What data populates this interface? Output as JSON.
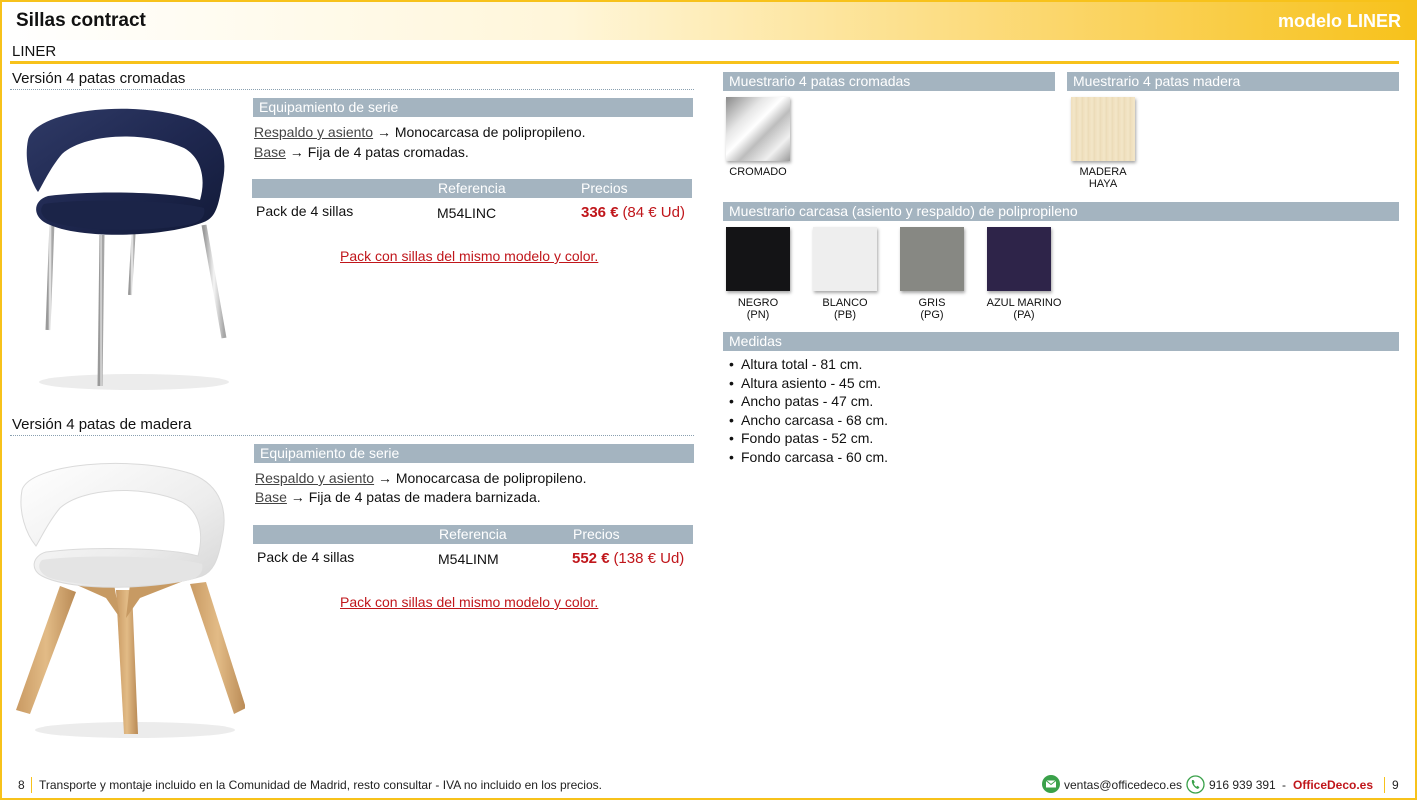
{
  "header": {
    "title": "Sillas contract",
    "model": "modelo LINER"
  },
  "model_name": "LINER",
  "versions": [
    {
      "title": "Versión 4 patas cromadas",
      "equip_title": "Equipamiento de serie",
      "spec1_label": "Respaldo y asiento",
      "spec1_text": " → Monocarcasa de polipropileno.",
      "spec2_label": "Base",
      "spec2_text": " → Fija de 4 patas cromadas.",
      "table": {
        "col_ref": "Referencia",
        "col_price": "Precios",
        "item": "Pack de 4 sillas",
        "ref": "M54LINC",
        "price": "336 €",
        "unit_price": "(84 € Ud)"
      },
      "note": "Pack con sillas del mismo modelo y color."
    },
    {
      "title": "Versión 4 patas de madera",
      "equip_title": "Equipamiento de serie",
      "spec1_label": "Respaldo y asiento",
      "spec1_text": " → Monocarcasa de polipropileno.",
      "spec2_label": "Base",
      "spec2_text": " → Fija de 4 patas de madera barnizada.",
      "table": {
        "col_ref": "Referencia",
        "col_price": "Precios",
        "item": "Pack de 4 sillas",
        "ref": "M54LINM",
        "price": "552 €",
        "unit_price": "(138 € Ud)"
      },
      "note": "Pack con sillas del mismo modelo y color."
    }
  ],
  "samples": {
    "chrome": {
      "title": "Muestrario 4 patas cromadas",
      "label": "CROMADO"
    },
    "wood": {
      "title": "Muestrario 4 patas madera",
      "label1": "MADERA",
      "label2": "HAYA"
    },
    "shell": {
      "title": "Muestrario carcasa (asiento y respaldo) de polipropileno",
      "colors": [
        {
          "name": "NEGRO",
          "code": "(PN)",
          "color": "#141416"
        },
        {
          "name": "BLANCO",
          "code": "(PB)",
          "color": "#eeeeee"
        },
        {
          "name": "GRIS",
          "code": "(PG)",
          "color": "#878883"
        },
        {
          "name": "AZUL MARINO",
          "code": "(PA)",
          "color": "#2e2449"
        }
      ]
    }
  },
  "measures": {
    "title": "Medidas",
    "items": [
      "Altura total - 81 cm.",
      "Altura asiento - 45 cm.",
      "Ancho patas - 47 cm.",
      "Ancho carcasa - 68 cm.",
      "Fondo patas - 52 cm.",
      "Fondo carcasa - 60 cm."
    ]
  },
  "footer": {
    "page_left": "8",
    "note": "Transporte y montaje incluido en la Comunidad de Madrid, resto consultar - IVA no incluido en los precios.",
    "email": "ventas@officedeco.es",
    "phone": "916 939 391",
    "dash": "-",
    "brand": "OfficeDeco.es",
    "page_right": "9"
  }
}
